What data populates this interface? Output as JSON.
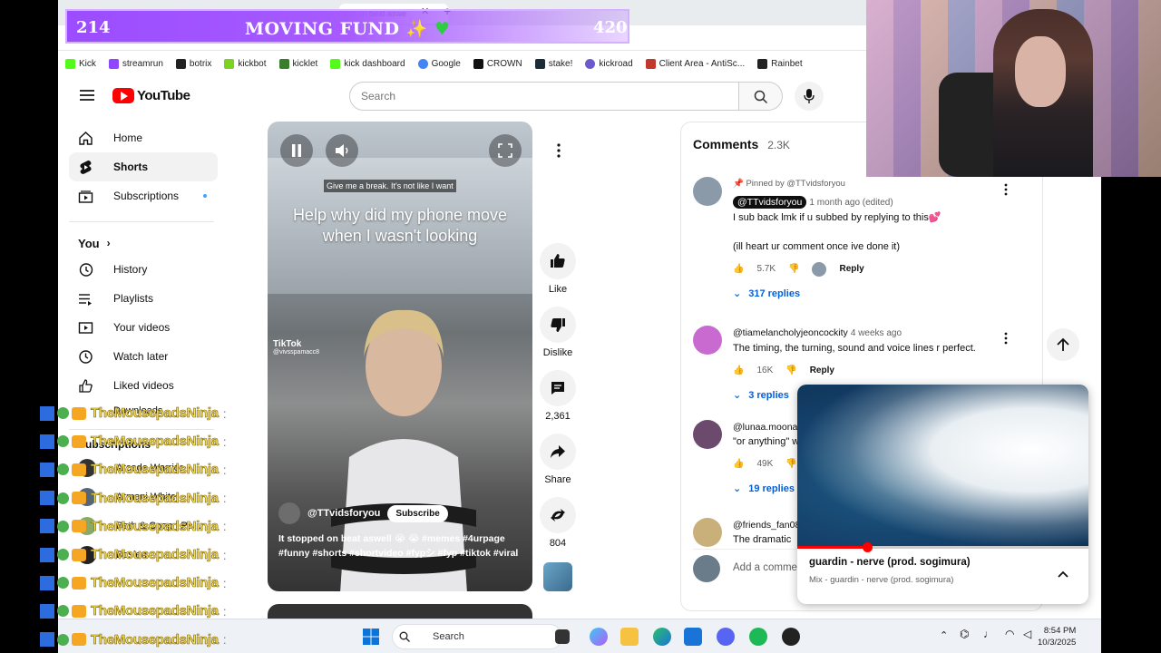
{
  "browser": {
    "tab_title": "ed on beat aswe",
    "bookmarks": [
      "Kick",
      "streamrun",
      "botrix",
      "kickbot",
      "kicklet",
      "kick dashboard",
      "Google",
      "CROWN",
      "stake!",
      "kickroad",
      "Client Area - AntiSc...",
      "Rainbet"
    ]
  },
  "youtube": {
    "logo_text": "YouTube",
    "search_placeholder": "Search",
    "sidebar": {
      "items": [
        {
          "label": "Home",
          "icon": "home-icon"
        },
        {
          "label": "Shorts",
          "icon": "shorts-icon"
        },
        {
          "label": "Subscriptions",
          "icon": "subscriptions-icon"
        }
      ],
      "you_label": "You",
      "you_items": [
        {
          "label": "History",
          "icon": "history-icon"
        },
        {
          "label": "Playlists",
          "icon": "playlists-icon"
        },
        {
          "label": "Your videos",
          "icon": "your-videos-icon"
        },
        {
          "label": "Watch later",
          "icon": "watch-later-icon"
        },
        {
          "label": "Liked videos",
          "icon": "liked-videos-icon"
        },
        {
          "label": "Downloads",
          "icon": "downloads-icon"
        }
      ],
      "subscriptions_label": "Subscriptions",
      "subs": [
        "Arcade Warrior",
        "Armani White",
        "Beth & Coop | Pa...",
        "Boslen"
      ]
    },
    "short": {
      "caption_top": "Give me a break. It's not like I want",
      "headline": "Help why did my phone move when I wasn't looking",
      "watermark": "TikTok",
      "watermark_handle": "@vivsspamacc8",
      "channel": "@TTvidsforyou",
      "subscribe": "Subscribe",
      "description": "It stopped on beat aswell 😭 😭 #memes #4urpage #funny #shorts #shortvideo #fypシ #fyp #tiktok #viral"
    },
    "actions": {
      "like": "Like",
      "dislike": "Dislike",
      "comments_count": "2,361",
      "share": "Share",
      "remix_count": "804"
    },
    "comments": {
      "title": "Comments",
      "count": "2.3K",
      "list": [
        {
          "pinned": "Pinned by @TTvidsforyou",
          "author": "@TTvidsforyou",
          "time": "1 month ago (edited)",
          "text1": "I sub back lmk if u subbed by replying to this💕",
          "text2": "(ill heart ur comment once ive done it)",
          "likes": "5.7K",
          "reply": "Reply",
          "replies": "317 replies"
        },
        {
          "author": "@tiamelancholyjeoncockity",
          "time": "4 weeks ago",
          "text1": "The timing, the turning, sound and voice lines r perfect.",
          "likes": "16K",
          "reply": "Reply",
          "replies": "3 replies"
        },
        {
          "author": "@lunaa.moona",
          "text1": "\"or anything\" w",
          "likes": "49K",
          "replies": "19 replies"
        },
        {
          "author": "@friends_fan08",
          "text1": "The dramatic"
        }
      ],
      "add_placeholder": "Add a comment"
    },
    "miniplayer": {
      "title": "guardin - nerve (prod. sogimura)",
      "subtitle": "Mix - guardin - nerve (prod. sogimura)",
      "progress": 0.24
    }
  },
  "taskbar": {
    "search": "Search",
    "time": "8:54 PM",
    "date": "10/3/2025"
  },
  "overlay": {
    "fund_left": "214",
    "fund_title": "MOVING FUND",
    "fund_right": "420",
    "chat_name": "TheMousepadsNinja",
    "chat_rows": 9
  },
  "colors": {
    "youtube_red": "#ff0000",
    "link_blue": "#065fd4",
    "fund_purple": "#9b4dff",
    "chat_yellow": "#f5e35a"
  }
}
